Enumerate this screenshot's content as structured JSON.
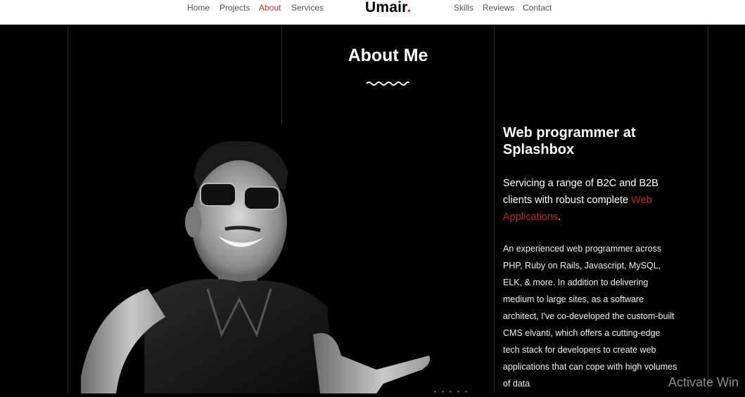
{
  "nav": {
    "home": "Home",
    "projects": "Projects",
    "about": "About",
    "services": "Services",
    "brand": "Umair",
    "brand_dot": ".",
    "skills": "Skills",
    "reviews": "Reviews",
    "contact": "Contact",
    "active_color": "#c0392b"
  },
  "about": {
    "title": "About Me",
    "headline": "Web programmer at Splashbox",
    "lead_prefix": "Servicing a range of B2C and B2B clients with robust complete ",
    "lead_link": "Web Applications",
    "lead_suffix": ".",
    "body": "An experienced web programmer across PHP, Ruby on Rails, Javascript, MySQL, ELK, & more. In addition to delivering medium to large sites, as a software architect, I've co-developed the custom-built CMS elvanti, which offers a cutting-edge tech stack for developers to create web applications that can cope with high volumes of data",
    "accent_color": "#b22a2a"
  },
  "slider": {
    "dots": "• • • • •"
  },
  "watermark": "Activate Win"
}
